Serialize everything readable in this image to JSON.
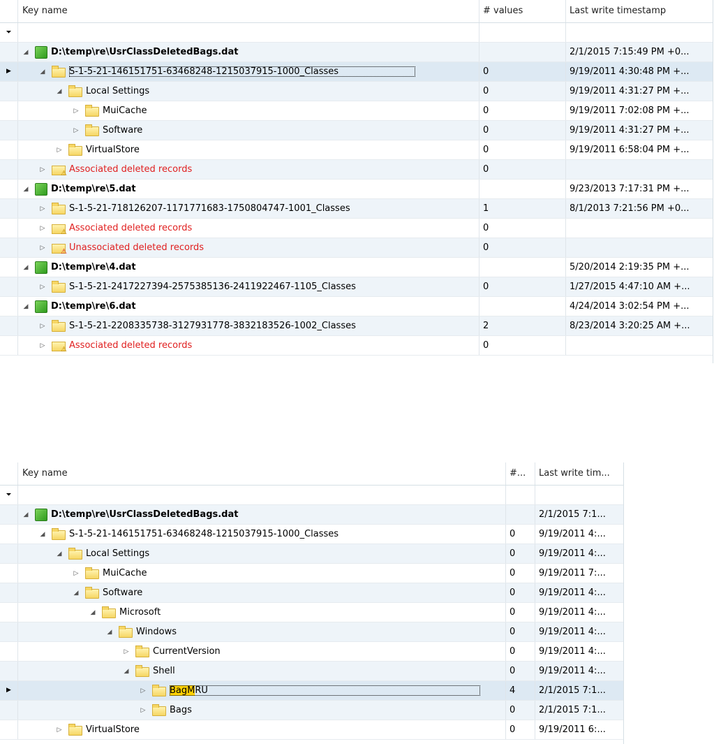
{
  "top": {
    "columns": [
      "Key name",
      "# values",
      "Last write timestamp"
    ],
    "rows": [
      {
        "level": 0,
        "expander": "◢",
        "icon": "hive-icon",
        "label": "D:\\temp\\re\\UsrClassDeletedBags.dat",
        "bold": true,
        "values": "",
        "timestamp": "2/1/2015 7:15:49 PM +0..."
      },
      {
        "level": 1,
        "expander": "◢",
        "icon": "folder-icon",
        "label": "S-1-5-21-146151751-63468248-1215037915-1000_Classes",
        "values": "0",
        "timestamp": "9/19/2011 4:30:48 PM +...",
        "selected": true
      },
      {
        "level": 2,
        "expander": "◢",
        "icon": "folder-icon",
        "label": "Local Settings",
        "values": "0",
        "timestamp": "9/19/2011 4:31:27 PM +..."
      },
      {
        "level": 3,
        "expander": "▷",
        "icon": "folder-icon",
        "label": "MuiCache",
        "values": "0",
        "timestamp": "9/19/2011 7:02:08 PM +..."
      },
      {
        "level": 3,
        "expander": "▷",
        "icon": "folder-icon",
        "label": "Software",
        "values": "0",
        "timestamp": "9/19/2011 4:31:27 PM +..."
      },
      {
        "level": 2,
        "expander": "▷",
        "icon": "folder-icon",
        "label": "VirtualStore",
        "values": "0",
        "timestamp": "9/19/2011 6:58:04 PM +..."
      },
      {
        "level": 1,
        "expander": "▷",
        "icon": "warning-folder-icon",
        "label": "Associated deleted records",
        "red": true,
        "values": "0",
        "timestamp": ""
      },
      {
        "level": 0,
        "expander": "◢",
        "icon": "hive-icon",
        "label": "D:\\temp\\re\\5.dat",
        "bold": true,
        "values": "",
        "timestamp": "9/23/2013 7:17:31 PM +..."
      },
      {
        "level": 1,
        "expander": "▷",
        "icon": "folder-icon",
        "label": "S-1-5-21-718126207-1171771683-1750804747-1001_Classes",
        "values": "1",
        "timestamp": "8/1/2013 7:21:56 PM +0..."
      },
      {
        "level": 1,
        "expander": "▷",
        "icon": "warning-folder-icon",
        "label": "Associated deleted records",
        "red": true,
        "values": "0",
        "timestamp": ""
      },
      {
        "level": 1,
        "expander": "▷",
        "icon": "warning-folder-red-icon",
        "label": "Unassociated deleted records",
        "red": true,
        "values": "0",
        "timestamp": ""
      },
      {
        "level": 0,
        "expander": "◢",
        "icon": "hive-icon",
        "label": "D:\\temp\\re\\4.dat",
        "bold": true,
        "values": "",
        "timestamp": "5/20/2014 2:19:35 PM +..."
      },
      {
        "level": 1,
        "expander": "▷",
        "icon": "folder-icon",
        "label": "S-1-5-21-2417227394-2575385136-2411922467-1105_Classes",
        "values": "0",
        "timestamp": "1/27/2015 4:47:10 AM +..."
      },
      {
        "level": 0,
        "expander": "◢",
        "icon": "hive-icon",
        "label": "D:\\temp\\re\\6.dat",
        "bold": true,
        "values": "",
        "timestamp": "4/24/2014 3:02:54 PM +..."
      },
      {
        "level": 1,
        "expander": "▷",
        "icon": "folder-icon",
        "label": "S-1-5-21-2208335738-3127931778-3832183526-1002_Classes",
        "values": "2",
        "timestamp": "8/23/2014 3:20:25 AM +..."
      },
      {
        "level": 1,
        "expander": "▷",
        "icon": "warning-folder-icon",
        "label": "Associated deleted records",
        "red": true,
        "values": "0",
        "timestamp": ""
      }
    ]
  },
  "bottom": {
    "columns": [
      "Key name",
      "#...",
      "Last write tim..."
    ],
    "search_highlight": "BagM",
    "rows": [
      {
        "level": 0,
        "expander": "◢",
        "icon": "hive-icon",
        "label": "D:\\temp\\re\\UsrClassDeletedBags.dat",
        "bold": true,
        "values": "",
        "timestamp": "2/1/2015 7:1..."
      },
      {
        "level": 1,
        "expander": "◢",
        "icon": "folder-icon",
        "label": "S-1-5-21-146151751-63468248-1215037915-1000_Classes",
        "values": "0",
        "timestamp": "9/19/2011 4:..."
      },
      {
        "level": 2,
        "expander": "◢",
        "icon": "folder-icon",
        "label": "Local Settings",
        "values": "0",
        "timestamp": "9/19/2011 4:..."
      },
      {
        "level": 3,
        "expander": "▷",
        "icon": "folder-icon",
        "label": "MuiCache",
        "values": "0",
        "timestamp": "9/19/2011 7:..."
      },
      {
        "level": 3,
        "expander": "◢",
        "icon": "folder-icon",
        "label": "Software",
        "values": "0",
        "timestamp": "9/19/2011 4:..."
      },
      {
        "level": 4,
        "expander": "◢",
        "icon": "folder-icon",
        "label": "Microsoft",
        "values": "0",
        "timestamp": "9/19/2011 4:..."
      },
      {
        "level": 5,
        "expander": "◢",
        "icon": "folder-icon",
        "label": "Windows",
        "values": "0",
        "timestamp": "9/19/2011 4:..."
      },
      {
        "level": 6,
        "expander": "▷",
        "icon": "folder-icon",
        "label": "CurrentVersion",
        "values": "0",
        "timestamp": "9/19/2011 4:..."
      },
      {
        "level": 6,
        "expander": "◢",
        "icon": "folder-icon",
        "label": "Shell",
        "values": "0",
        "timestamp": "9/19/2011 4:..."
      },
      {
        "level": 7,
        "expander": "▷",
        "icon": "folder-icon",
        "label": "BagMRU",
        "values": "4",
        "timestamp": "2/1/2015 7:1...",
        "selected": true,
        "highlight": true
      },
      {
        "level": 7,
        "expander": "▷",
        "icon": "folder-icon",
        "label": "Bags",
        "values": "0",
        "timestamp": "2/1/2015 7:1..."
      },
      {
        "level": 2,
        "expander": "▷",
        "icon": "folder-icon",
        "label": "VirtualStore",
        "values": "0",
        "timestamp": "9/19/2011 6:..."
      }
    ]
  }
}
